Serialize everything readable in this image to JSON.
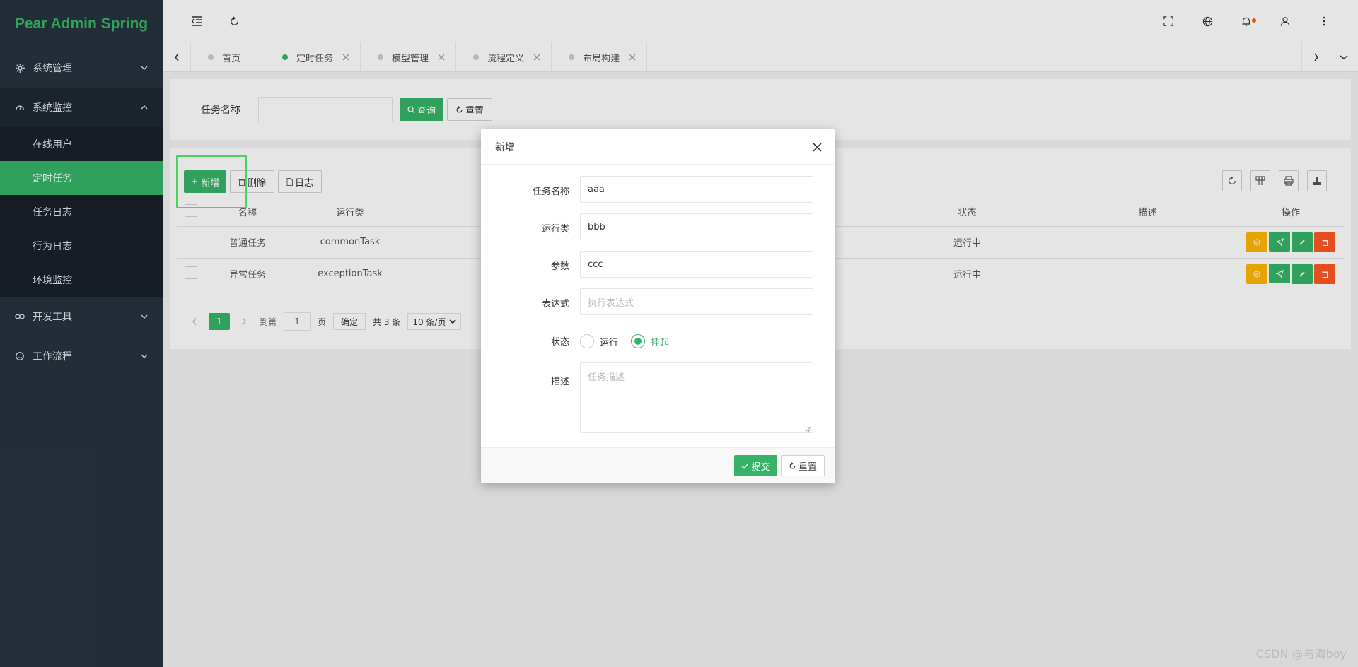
{
  "app": {
    "title": "Pear Admin Spring"
  },
  "sidebar": {
    "items": [
      {
        "label": "系统管理",
        "icon": "gear-icon"
      },
      {
        "label": "系统监控",
        "icon": "dashboard-icon"
      },
      {
        "label": "开发工具",
        "icon": "link-icon"
      },
      {
        "label": "工作流程",
        "icon": "smile-icon"
      }
    ],
    "submenu": [
      {
        "label": "在线用户"
      },
      {
        "label": "定时任务"
      },
      {
        "label": "任务日志"
      },
      {
        "label": "行为日志"
      },
      {
        "label": "环境监控"
      }
    ]
  },
  "tabs": [
    {
      "label": "首页"
    },
    {
      "label": "定时任务"
    },
    {
      "label": "模型管理"
    },
    {
      "label": "流程定义"
    },
    {
      "label": "布局构建"
    }
  ],
  "search": {
    "label": "任务名称",
    "query_label": "查询",
    "reset_label": "重置"
  },
  "toolbar": {
    "add_label": "新增",
    "delete_label": "删除",
    "log_label": "日志"
  },
  "table": {
    "columns": [
      "名称",
      "运行类",
      "状态",
      "描述",
      "操作"
    ],
    "rows": [
      {
        "name": "普通任务",
        "class": "commonTask",
        "status": "运行中",
        "desc": ""
      },
      {
        "name": "异常任务",
        "class": "exceptionTask",
        "status": "运行中",
        "desc": ""
      }
    ]
  },
  "pager": {
    "page": "1",
    "goto_label": "到第",
    "goto_value": "1",
    "page_unit": "页",
    "confirm_label": "确定",
    "total": "共 3 条",
    "per_page": "10 条/页"
  },
  "modal": {
    "title": "新增",
    "fields": {
      "name": {
        "label": "任务名称",
        "value": "aaa"
      },
      "class": {
        "label": "运行类",
        "value": "bbb"
      },
      "params": {
        "label": "参数",
        "value": "ccc"
      },
      "cron": {
        "label": "表达式",
        "placeholder": "执行表达式"
      },
      "status": {
        "label": "状态",
        "options": [
          "运行",
          "挂起"
        ],
        "selected": "挂起"
      },
      "desc": {
        "label": "描述",
        "placeholder": "任务描述"
      }
    },
    "submit_label": "提交",
    "reset_label": "重置"
  },
  "watermark": "CSDN @与海boy",
  "colors": {
    "primary": "#36b368",
    "sidebar": "#28333e",
    "orange": "#ffb800",
    "red": "#ff5722"
  }
}
